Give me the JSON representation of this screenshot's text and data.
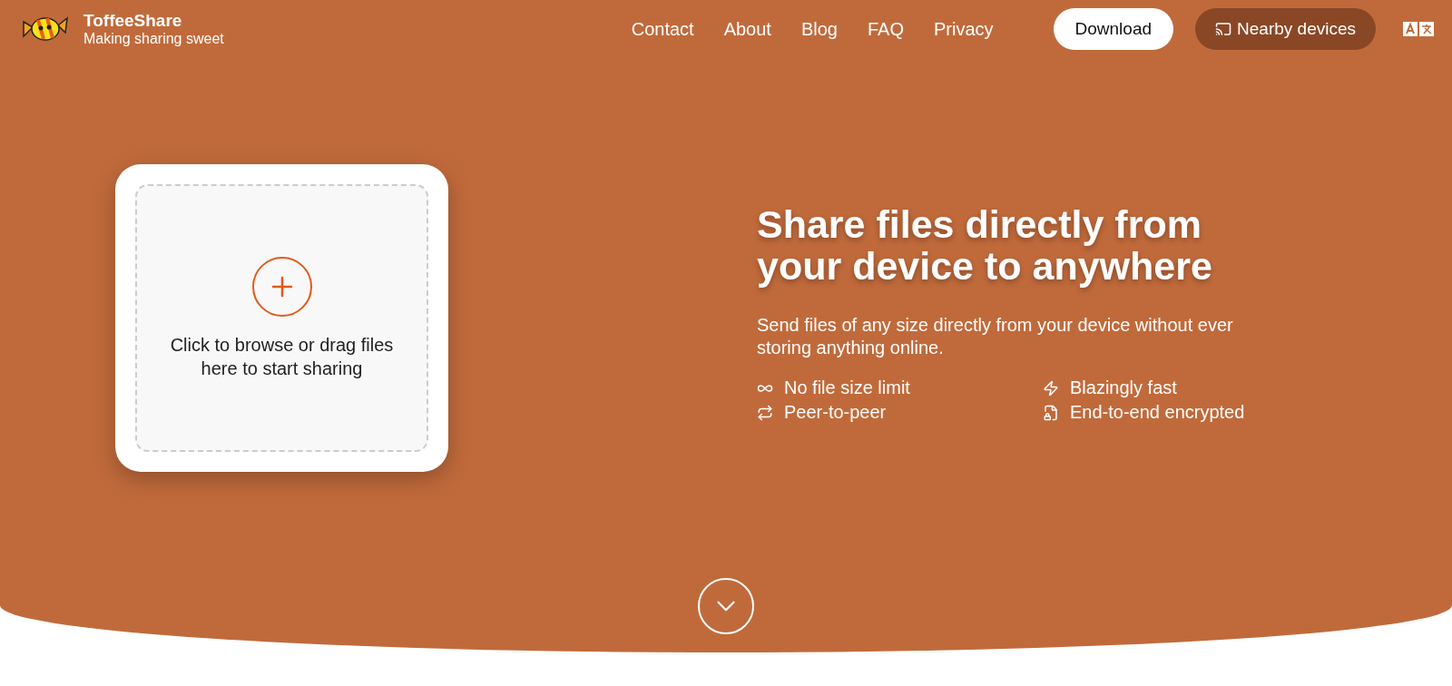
{
  "brand": {
    "name": "ToffeeShare",
    "tagline": "Making sharing sweet"
  },
  "nav": [
    "Contact",
    "About",
    "Blog",
    "FAQ",
    "Privacy"
  ],
  "download_button": "Download",
  "nearby_button": "Nearby devices",
  "dropzone": {
    "text": "Click to browse or drag files here to start sharing"
  },
  "headline": "Share files directly from your device to anywhere",
  "subtitle": "Send files of any size directly from your device without ever storing anything online.",
  "features": [
    {
      "kind": "infinity",
      "label": "No file size limit"
    },
    {
      "kind": "bolt",
      "label": "Blazingly fast"
    },
    {
      "kind": "swap",
      "label": "Peer-to-peer"
    },
    {
      "kind": "lockfile",
      "label": "End-to-end encrypted"
    }
  ]
}
